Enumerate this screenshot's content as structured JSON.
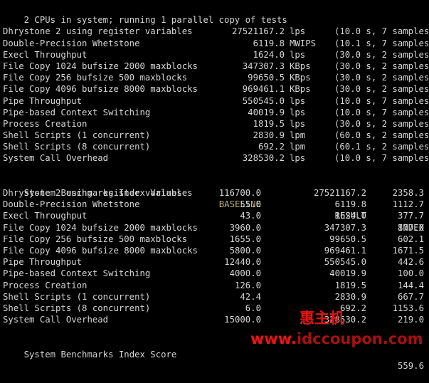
{
  "terminal": {
    "header_line": "2 CPUs in system; running 1 parallel copy of tests",
    "run_results": {
      "rows": [
        {
          "name": "Dhrystone 2 using register variables",
          "value": "27521167.2",
          "unit": "lps",
          "samples": "(10.0 s, 7 samples)"
        },
        {
          "name": "Double-Precision Whetstone",
          "value": "6119.8",
          "unit": "MWIPS",
          "samples": "(10.1 s, 7 samples)"
        },
        {
          "name": "Execl Throughput",
          "value": "1624.0",
          "unit": "lps",
          "samples": "(30.0 s, 2 samples)"
        },
        {
          "name": "File Copy 1024 bufsize 2000 maxblocks",
          "value": "347307.3",
          "unit": "KBps",
          "samples": "(30.0 s, 2 samples)"
        },
        {
          "name": "File Copy 256 bufsize 500 maxblocks",
          "value": "99650.5",
          "unit": "KBps",
          "samples": "(30.0 s, 2 samples)"
        },
        {
          "name": "File Copy 4096 bufsize 8000 maxblocks",
          "value": "969461.1",
          "unit": "KBps",
          "samples": "(30.0 s, 2 samples)"
        },
        {
          "name": "Pipe Throughput",
          "value": "550545.0",
          "unit": "lps",
          "samples": "(10.0 s, 7 samples)"
        },
        {
          "name": "Pipe-based Context Switching",
          "value": "40019.9",
          "unit": "lps",
          "samples": "(10.0 s, 7 samples)"
        },
        {
          "name": "Process Creation",
          "value": "1819.5",
          "unit": "lps",
          "samples": "(30.0 s, 2 samples)"
        },
        {
          "name": "Shell Scripts (1 concurrent)",
          "value": "2830.9",
          "unit": "lpm",
          "samples": "(60.0 s, 2 samples)"
        },
        {
          "name": "Shell Scripts (8 concurrent)",
          "value": "692.2",
          "unit": "lpm",
          "samples": "(60.1 s, 2 samples)"
        },
        {
          "name": "System Call Overhead",
          "value": "328530.2",
          "unit": "lps",
          "samples": "(10.0 s, 7 samples)"
        }
      ]
    },
    "index_table": {
      "title": "System Benchmarks Index Values",
      "columns": [
        "BASELINE",
        "RESULT",
        "INDEX"
      ],
      "rows": [
        {
          "name": "Dhrystone 2 using register variables",
          "baseline": "116700.0",
          "result": "27521167.2",
          "index": "2358.3"
        },
        {
          "name": "Double-Precision Whetstone",
          "baseline": "55.0",
          "result": "6119.8",
          "index": "1112.7"
        },
        {
          "name": "Execl Throughput",
          "baseline": "43.0",
          "result": "1624.0",
          "index": "377.7"
        },
        {
          "name": "File Copy 1024 bufsize 2000 maxblocks",
          "baseline": "3960.0",
          "result": "347307.3",
          "index": "877.0"
        },
        {
          "name": "File Copy 256 bufsize 500 maxblocks",
          "baseline": "1655.0",
          "result": "99650.5",
          "index": "602.1"
        },
        {
          "name": "File Copy 4096 bufsize 8000 maxblocks",
          "baseline": "5800.0",
          "result": "969461.1",
          "index": "1671.5"
        },
        {
          "name": "Pipe Throughput",
          "baseline": "12440.0",
          "result": "550545.0",
          "index": "442.6"
        },
        {
          "name": "Pipe-based Context Switching",
          "baseline": "4000.0",
          "result": "40019.9",
          "index": "100.0"
        },
        {
          "name": "Process Creation",
          "baseline": "126.0",
          "result": "1819.5",
          "index": "144.4"
        },
        {
          "name": "Shell Scripts (1 concurrent)",
          "baseline": "42.4",
          "result": "2830.9",
          "index": "667.7"
        },
        {
          "name": "Shell Scripts (8 concurrent)",
          "baseline": "6.0",
          "result": "692.2",
          "index": "1153.6"
        },
        {
          "name": "System Call Overhead",
          "baseline": "15000.0",
          "result": "328530.2",
          "index": "219.0"
        }
      ],
      "score_label": "System Benchmarks Index Score",
      "score_value": "559.6"
    },
    "watermark": {
      "brand": "惠主机",
      "url_prefix": "www.",
      "url_domain": "idccoupon.com"
    },
    "colors": {
      "background": "#000000",
      "text": "#d6d6d6",
      "baseline_header": "#bfae6e",
      "watermark_bright": "#e81414",
      "watermark_dark": "#a81010"
    }
  }
}
